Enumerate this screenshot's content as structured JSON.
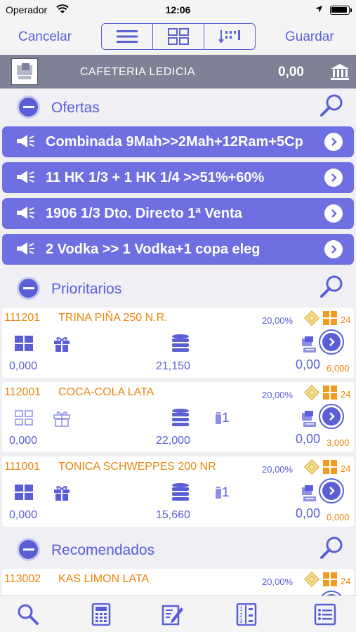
{
  "status": {
    "carrier": "Operador",
    "time": "12:06"
  },
  "nav": {
    "cancel_label": "Cancelar",
    "save_label": "Guardar"
  },
  "header": {
    "client_name": "CAFETERIA LEDICIA",
    "total": "0,00"
  },
  "sections": {
    "ofertas": {
      "title": "Ofertas"
    },
    "prioritarios": {
      "title": "Prioritarios"
    },
    "recomendados": {
      "title": "Recomendados"
    }
  },
  "offers": [
    {
      "label": "Combinada 9Mah>>2Mah+12Ram+5Cp"
    },
    {
      "label": "11 HK 1/3 + 1 HK 1/4 >>51%+60%"
    },
    {
      "label": "1906 1/3 Dto. Directo 1ª Venta"
    },
    {
      "label": "2 Vodka >> 1 Vodka+1 copa eleg"
    }
  ],
  "products": [
    {
      "code": "111201",
      "name": "TRINA PIÑA 250 N.R.",
      "discount": "20,00%",
      "units": "24",
      "qty": "0,000",
      "stock": "21,150",
      "can_count": "",
      "amount": "0,00",
      "price": "6,000"
    },
    {
      "code": "112001",
      "name": "COCA-COLA LATA",
      "discount": "20,00%",
      "units": "24",
      "qty": "0,000",
      "stock": "22,000",
      "can_count": "1",
      "amount": "0,00",
      "price": "3,000"
    },
    {
      "code": "111001",
      "name": "TONICA SCHWEPPES 200 NR",
      "discount": "20,00%",
      "units": "24",
      "qty": "0,000",
      "stock": "15,660",
      "can_count": "1",
      "amount": "0,00",
      "price": "0,000"
    }
  ],
  "recommended": [
    {
      "code": "113002",
      "name": "KAS LIMON LATA",
      "discount": "20,00%",
      "units": "24"
    }
  ],
  "colors": {
    "accent": "#5b5fd6",
    "offer_bg": "#6e6fe0",
    "orange": "#e8870c",
    "header_bg": "#7f8196"
  }
}
